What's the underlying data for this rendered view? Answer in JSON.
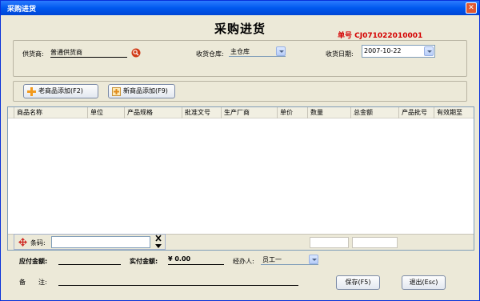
{
  "window": {
    "title": "采购进货",
    "close_symbol": "✕"
  },
  "form": {
    "title": "采购进货",
    "order_no_label": "单号",
    "order_no": "CJ071022010001"
  },
  "supplier": {
    "label": "供货商:",
    "value": "普通供货商"
  },
  "warehouse": {
    "label": "收货仓库:",
    "value": "主仓库"
  },
  "date": {
    "label": "收货日期:",
    "value": "2007-10-22"
  },
  "buttons": {
    "add_old": "老商品添加(F2)",
    "add_new": "新商品添加(F9)",
    "save": "保存(F5)",
    "exit": "退出(Esc)"
  },
  "table": {
    "columns": [
      "商品名称",
      "单位",
      "产品规格",
      "批准文号",
      "生产厂商",
      "单价",
      "数量",
      "总金额",
      "产品批号",
      "有效期至"
    ],
    "rows": []
  },
  "barcode": {
    "label": "条码:",
    "value": ""
  },
  "totals": {
    "payable_label": "应付金额:",
    "payable_value": "",
    "paid_label": "实付金额:",
    "paid_value": "¥ 0.00",
    "handler_label": "经办人:",
    "handler_value": "员工一"
  },
  "remark": {
    "label": "备　　注:",
    "value": ""
  },
  "colors": {
    "title_bar": "#0058ee",
    "order_no": "#d40000",
    "window_bg": "#ece9d8"
  },
  "icons": [
    "search-icon",
    "plus-icon",
    "new-item-icon",
    "move-icon",
    "close-icon",
    "arrow-up-icon",
    "arrow-down-icon",
    "dropdown-arrow-icon"
  ]
}
